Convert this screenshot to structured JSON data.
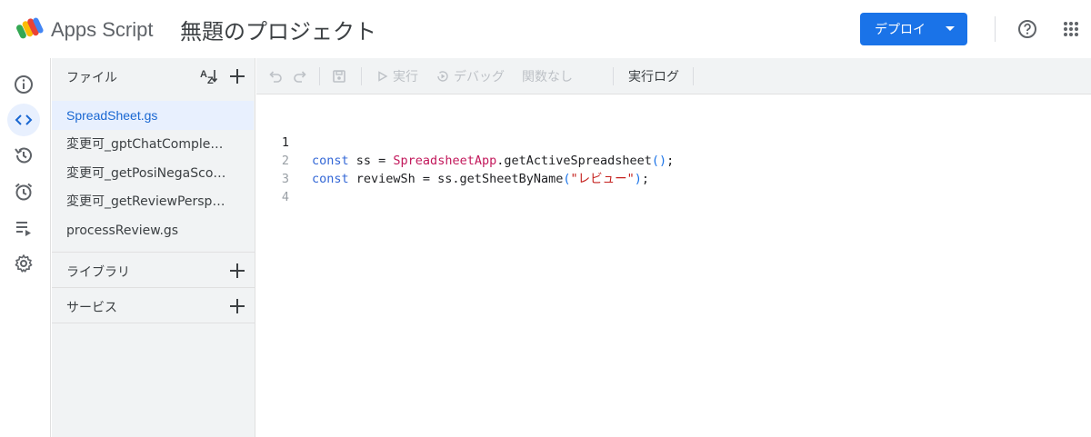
{
  "header": {
    "app_name": "Apps Script",
    "project_title": "無題のプロジェクト",
    "deploy_label": "デプロイ"
  },
  "rail": {
    "items": [
      "overview-icon",
      "editor-icon",
      "history-icon",
      "triggers-icon",
      "executions-icon",
      "settings-icon"
    ],
    "active": "editor-icon"
  },
  "files": {
    "title": "ファイル",
    "items": [
      {
        "label": "SpreadSheet.gs",
        "active": true
      },
      {
        "label": "変更可_gptChatCompletion..."
      },
      {
        "label": "変更可_getPosiNegaScore.gs"
      },
      {
        "label": "変更可_getReviewPerspecti..."
      },
      {
        "label": "processReview.gs"
      }
    ],
    "libraries_label": "ライブラリ",
    "services_label": "サービス"
  },
  "toolbar": {
    "run_label": "実行",
    "debug_label": "デバッグ",
    "function_label": "関数なし",
    "log_label": "実行ログ"
  },
  "editor": {
    "line_numbers": [
      "1",
      "2",
      "3",
      "4"
    ],
    "line1": {
      "kw": "const",
      "mid": " ss = ",
      "cls": "SpreadsheetApp",
      "rest": ".getActiveSpreadsheet",
      "paren": "()",
      "end": ";"
    },
    "line2": {
      "kw": "const",
      "mid": " reviewSh = ss.getSheetByName",
      "popen": "(",
      "str": "\"レビュー\"",
      "pclose": ")",
      "end": ";"
    }
  },
  "colors": {
    "accent": "#1a73e8",
    "panel_bg": "#f1f3f4",
    "active_bg": "#e8f0fe",
    "keyword": "#3367d6",
    "class": "#c2185b",
    "string": "#c5221f"
  }
}
